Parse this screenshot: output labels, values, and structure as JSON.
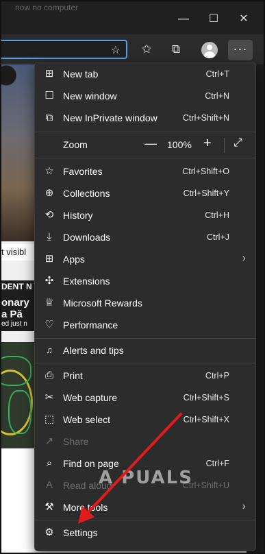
{
  "window": {
    "title": "now no computer",
    "controls": {
      "minimize": "—",
      "maximize": "☐",
      "close": "✕"
    }
  },
  "toolbar": {
    "add_favorite_icon": "star-plus-icon",
    "favorites_icon": "favorites-icon",
    "collections_icon": "collections-icon",
    "more_label": "···"
  },
  "background_page": {
    "snippet_1": "t visibl",
    "snippet_2": "DENT N",
    "snippet_3": "onary",
    "snippet_4": "a Pă",
    "snippet_5": "ed just n"
  },
  "menu": {
    "items": [
      {
        "label": "New tab",
        "shortcut": "Ctrl+T",
        "icon": "new-tab-icon",
        "glyph": "⊞"
      },
      {
        "label": "New window",
        "shortcut": "Ctrl+N",
        "icon": "new-window-icon",
        "glyph": "☐"
      },
      {
        "label": "New InPrivate window",
        "shortcut": "Ctrl+Shift+N",
        "icon": "inprivate-icon",
        "glyph": "⧉"
      },
      {
        "label": "Zoom",
        "icon": "zoom-icon"
      },
      {
        "label": "Favorites",
        "shortcut": "Ctrl+Shift+O",
        "icon": "favorites-icon",
        "glyph": "☆"
      },
      {
        "label": "Collections",
        "shortcut": "Ctrl+Shift+Y",
        "icon": "collections-icon",
        "glyph": "⊕"
      },
      {
        "label": "History",
        "shortcut": "Ctrl+H",
        "icon": "history-icon",
        "glyph": "⟲"
      },
      {
        "label": "Downloads",
        "shortcut": "Ctrl+J",
        "icon": "download-icon",
        "glyph": "⤓"
      },
      {
        "label": "Apps",
        "icon": "apps-icon",
        "glyph": "⊞"
      },
      {
        "label": "Extensions",
        "icon": "extensions-icon",
        "glyph": "✣"
      },
      {
        "label": "Microsoft Rewards",
        "icon": "rewards-icon",
        "glyph": "♕"
      },
      {
        "label": "Performance",
        "icon": "performance-icon",
        "glyph": "♡"
      },
      {
        "label": "Alerts and tips",
        "icon": "bell-icon",
        "glyph": "🔔"
      },
      {
        "label": "Print",
        "shortcut": "Ctrl+P",
        "icon": "print-icon",
        "glyph": "⎙"
      },
      {
        "label": "Web capture",
        "shortcut": "Ctrl+Shift+S",
        "icon": "web-capture-icon",
        "glyph": "✂"
      },
      {
        "label": "Web select",
        "shortcut": "Ctrl+Shift+X",
        "icon": "web-select-icon",
        "glyph": "⬚"
      },
      {
        "label": "Share",
        "icon": "share-icon",
        "glyph": "↗"
      },
      {
        "label": "Find on page",
        "shortcut": "Ctrl+F",
        "icon": "find-icon",
        "glyph": "⌕"
      },
      {
        "label": "Read aloud",
        "shortcut": "Ctrl+Shift+U",
        "icon": "read-aloud-icon",
        "glyph": "A"
      },
      {
        "label": "More tools",
        "icon": "more-tools-icon",
        "glyph": "⚒"
      },
      {
        "label": "Settings",
        "icon": "gear-icon",
        "glyph": "⚙"
      }
    ],
    "zoom": {
      "minus": "—",
      "value": "100%",
      "plus": "+",
      "fullscreen_icon": "fullscreen-icon",
      "fullscreen_glyph": "⤢"
    }
  },
  "watermark": {
    "text": "A PUALS"
  },
  "colors": {
    "menu_bg": "#2c2c2c",
    "accent_border": "#5aa0e8",
    "arrow": "#e21b1b"
  }
}
